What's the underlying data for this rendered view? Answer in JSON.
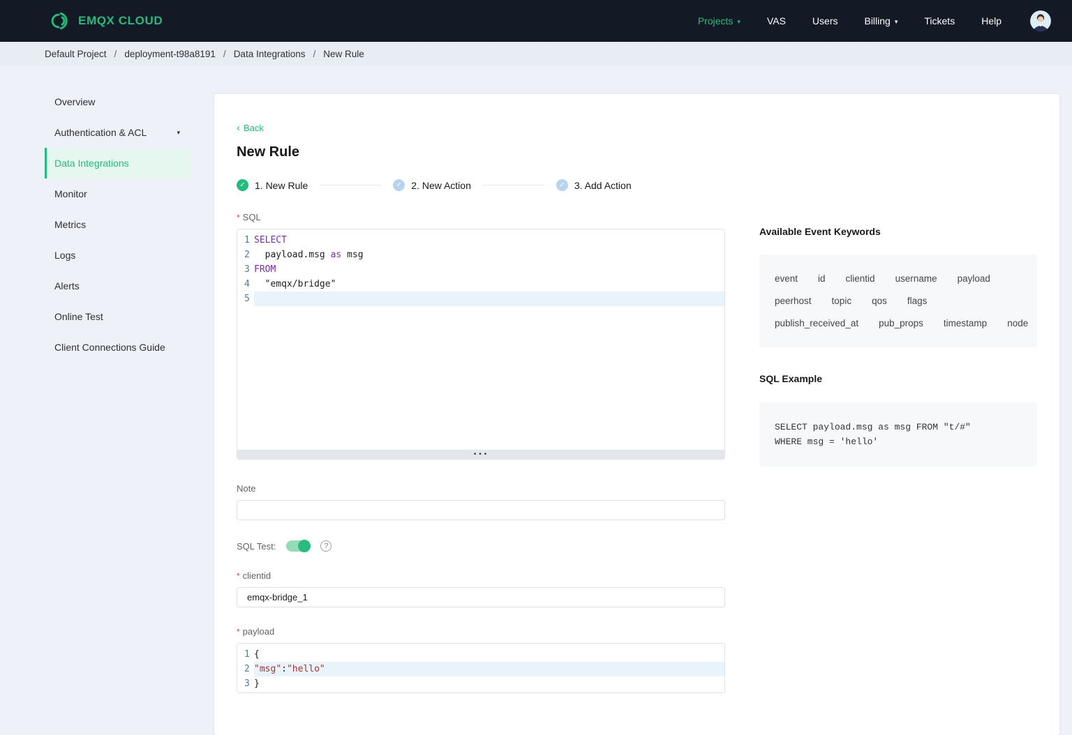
{
  "theme": {
    "brand_green": "#1fbe7c",
    "navbar_bg": "#141926",
    "pending_step_blue": "#b7d3ee",
    "keyword_purple": "#7a29cc",
    "string_red": "#b2302c",
    "required_red": "#f04134"
  },
  "icons": {
    "dropdown_caret": "▾",
    "back_chevron": "‹",
    "check": "✓",
    "help": "?",
    "resize_ellipsis": "•••"
  },
  "required_mark": "*",
  "navbar": {
    "logo_text": "EMQX CLOUD",
    "menu": [
      {
        "label": "Projects",
        "active": true,
        "dropdown": true
      },
      {
        "label": "VAS",
        "active": false,
        "dropdown": false
      },
      {
        "label": "Users",
        "active": false,
        "dropdown": false
      },
      {
        "label": "Billing",
        "active": false,
        "dropdown": true
      },
      {
        "label": "Tickets",
        "active": false,
        "dropdown": false
      },
      {
        "label": "Help",
        "active": false,
        "dropdown": false
      }
    ]
  },
  "breadcrumb": {
    "separator": "/",
    "items": [
      "Default Project",
      "deployment-t98a8191",
      "Data Integrations",
      "New Rule"
    ]
  },
  "sidebar": {
    "items": [
      {
        "label": "Overview",
        "active": false,
        "dropdown": false
      },
      {
        "label": "Authentication & ACL",
        "active": false,
        "dropdown": true
      },
      {
        "label": "Data Integrations",
        "active": true,
        "dropdown": false
      },
      {
        "label": "Monitor",
        "active": false,
        "dropdown": false
      },
      {
        "label": "Metrics",
        "active": false,
        "dropdown": false
      },
      {
        "label": "Logs",
        "active": false,
        "dropdown": false
      },
      {
        "label": "Alerts",
        "active": false,
        "dropdown": false
      },
      {
        "label": "Online Test",
        "active": false,
        "dropdown": false
      },
      {
        "label": "Client Connections Guide",
        "active": false,
        "dropdown": false
      }
    ]
  },
  "main": {
    "back_label": "Back",
    "title": "New Rule",
    "steps": [
      {
        "label": "1. New Rule",
        "state": "done"
      },
      {
        "label": "2. New Action",
        "state": "pending"
      },
      {
        "label": "3. Add Action",
        "state": "pending"
      }
    ],
    "sql": {
      "label": "SQL",
      "lines": [
        {
          "num": 1,
          "active": false,
          "tokens": [
            {
              "text": "SELECT",
              "type": "kw"
            }
          ]
        },
        {
          "num": 2,
          "active": false,
          "tokens": [
            {
              "text": "  payload.msg ",
              "type": "plain"
            },
            {
              "text": "as",
              "type": "kw"
            },
            {
              "text": " msg",
              "type": "plain"
            }
          ]
        },
        {
          "num": 3,
          "active": false,
          "tokens": [
            {
              "text": "FROM",
              "type": "kw"
            }
          ]
        },
        {
          "num": 4,
          "active": false,
          "tokens": [
            {
              "text": "  \"emqx/bridge\"",
              "type": "plain"
            }
          ]
        },
        {
          "num": 5,
          "active": true,
          "tokens": []
        }
      ]
    },
    "note": {
      "label": "Note",
      "value": ""
    },
    "sql_test": {
      "label": "SQL Test:",
      "enabled": true
    },
    "clientid": {
      "label": "clientid",
      "value": "emqx-bridge_1"
    },
    "payload": {
      "label": "payload",
      "lines": [
        {
          "num": 1,
          "active": false,
          "tokens": [
            {
              "text": "{",
              "type": "plain"
            }
          ]
        },
        {
          "num": 2,
          "active": true,
          "tokens": [
            {
              "text": "\"msg\"",
              "type": "str"
            },
            {
              "text": ":",
              "type": "plain"
            },
            {
              "text": "\"hello\"",
              "type": "str"
            }
          ]
        },
        {
          "num": 3,
          "active": false,
          "tokens": [
            {
              "text": "}",
              "type": "plain"
            }
          ]
        }
      ]
    }
  },
  "aside": {
    "keywords_title": "Available Event Keywords",
    "keywords": [
      "event",
      "id",
      "clientid",
      "username",
      "payload",
      "peerhost",
      "topic",
      "qos",
      "flags",
      "publish_received_at",
      "pub_props",
      "timestamp",
      "node"
    ],
    "example_title": "SQL Example",
    "example_lines": [
      "SELECT payload.msg as msg FROM \"t/#\"",
      "WHERE msg = 'hello'"
    ]
  }
}
